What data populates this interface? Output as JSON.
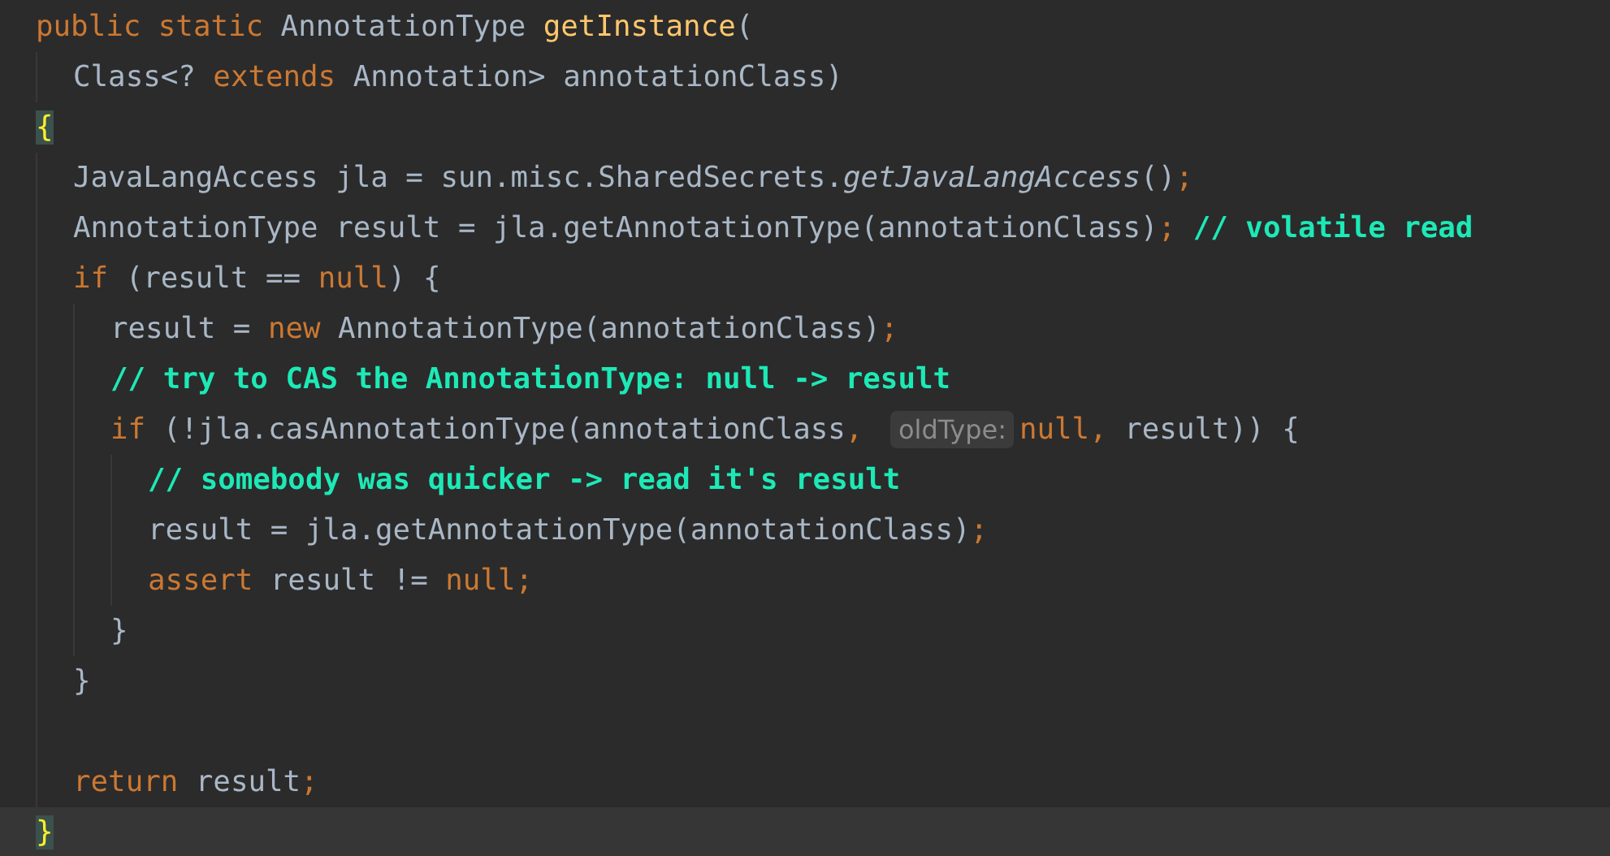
{
  "editor": {
    "lines": [
      {
        "tokens": [
          {
            "kind": "keyword",
            "text": "public static "
          },
          {
            "kind": "plain",
            "text": "AnnotationType "
          },
          {
            "kind": "method",
            "text": "getInstance"
          },
          {
            "kind": "plain",
            "text": "("
          }
        ],
        "children": [
          {
            "tokens": [
              {
                "kind": "plain",
                "text": "Class<? "
              },
              {
                "kind": "keyword",
                "text": "extends "
              },
              {
                "kind": "plain",
                "text": "Annotation> annotationClass)"
              }
            ]
          }
        ]
      },
      {
        "tokens": [
          {
            "kind": "brace",
            "text": "{"
          }
        ],
        "children": [
          {
            "tokens": [
              {
                "kind": "plain",
                "text": "JavaLangAccess jla = sun.misc.SharedSecrets."
              },
              {
                "kind": "italic",
                "text": "getJavaLangAccess"
              },
              {
                "kind": "plain",
                "text": "()"
              },
              {
                "kind": "keyword",
                "text": ";"
              }
            ]
          },
          {
            "tokens": [
              {
                "kind": "plain",
                "text": "AnnotationType result = jla.getAnnotationType(annotationClass)"
              },
              {
                "kind": "keyword",
                "text": "; "
              },
              {
                "kind": "comment",
                "text": "// volatile read"
              }
            ]
          },
          {
            "tokens": [
              {
                "kind": "keyword",
                "text": "if "
              },
              {
                "kind": "plain",
                "text": "(result == "
              },
              {
                "kind": "keyword",
                "text": "null"
              },
              {
                "kind": "plain",
                "text": ") {"
              }
            ],
            "children": [
              {
                "tokens": [
                  {
                    "kind": "plain",
                    "text": "result = "
                  },
                  {
                    "kind": "keyword",
                    "text": "new "
                  },
                  {
                    "kind": "plain",
                    "text": "AnnotationType(annotationClass)"
                  },
                  {
                    "kind": "keyword",
                    "text": ";"
                  }
                ]
              },
              {
                "tokens": [
                  {
                    "kind": "comment",
                    "text": "// try to CAS the AnnotationType: null -> result"
                  }
                ]
              },
              {
                "tokens": [
                  {
                    "kind": "keyword",
                    "text": "if "
                  },
                  {
                    "kind": "plain",
                    "text": "(!jla.casAnnotationType(annotationClass"
                  },
                  {
                    "kind": "keyword",
                    "text": ", "
                  },
                  {
                    "kind": "hint",
                    "text": "oldType:"
                  },
                  {
                    "kind": "keyword",
                    "text": "null, "
                  },
                  {
                    "kind": "plain",
                    "text": "result)) {"
                  }
                ],
                "children": [
                  {
                    "tokens": [
                      {
                        "kind": "comment",
                        "text": "// somebody was quicker -> read it's result"
                      }
                    ]
                  },
                  {
                    "tokens": [
                      {
                        "kind": "plain",
                        "text": "result = jla.getAnnotationType(annotationClass)"
                      },
                      {
                        "kind": "keyword",
                        "text": ";"
                      }
                    ]
                  },
                  {
                    "tokens": [
                      {
                        "kind": "keyword",
                        "text": "assert "
                      },
                      {
                        "kind": "plain",
                        "text": "result != "
                      },
                      {
                        "kind": "keyword",
                        "text": "null;"
                      }
                    ]
                  }
                ]
              },
              {
                "tokens": [
                  {
                    "kind": "plain",
                    "text": "}"
                  }
                ]
              }
            ]
          },
          {
            "blank_after": true,
            "tokens": [
              {
                "kind": "plain",
                "text": "}"
              }
            ]
          },
          {
            "tokens": [
              {
                "kind": "keyword",
                "text": "return "
              },
              {
                "kind": "plain",
                "text": "result"
              },
              {
                "kind": "keyword",
                "text": ";"
              }
            ]
          }
        ]
      },
      {
        "current": true,
        "tokens": [
          {
            "kind": "brace",
            "text": "}"
          }
        ]
      }
    ]
  }
}
